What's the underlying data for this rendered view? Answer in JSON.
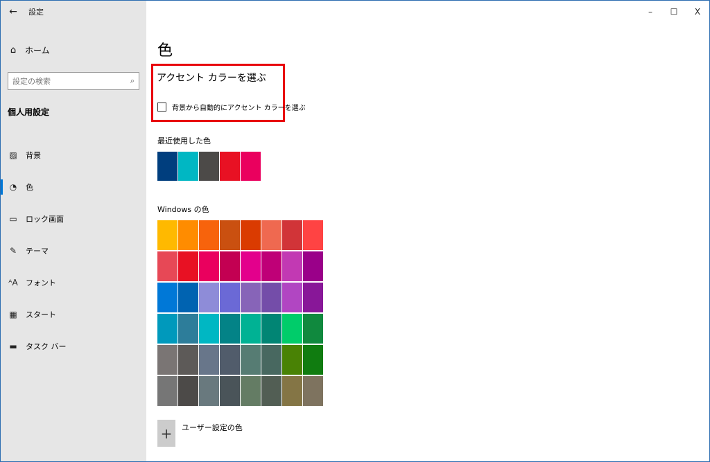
{
  "titlebar": {
    "app_title": "設定",
    "back_glyph": "←",
    "controls": {
      "minimize": "–",
      "maximize": "☐",
      "close": "X"
    }
  },
  "sidebar": {
    "home_label": "ホーム",
    "search_placeholder": "設定の検索",
    "section_title": "個人用設定",
    "items": [
      {
        "label": "背景",
        "icon": "image-icon",
        "glyph": "▨",
        "active": false
      },
      {
        "label": "色",
        "icon": "palette-icon",
        "glyph": "◔",
        "active": true
      },
      {
        "label": "ロック画面",
        "icon": "lock-screen-icon",
        "glyph": "▭",
        "active": false
      },
      {
        "label": "テーマ",
        "icon": "theme-icon",
        "glyph": "✎",
        "active": false
      },
      {
        "label": "フォント",
        "icon": "font-icon",
        "glyph": "ᴬA",
        "active": false
      },
      {
        "label": "スタート",
        "icon": "start-icon",
        "glyph": "▦",
        "active": false
      },
      {
        "label": "タスク バー",
        "icon": "taskbar-icon",
        "glyph": "▬",
        "active": false
      }
    ]
  },
  "main": {
    "page_title": "色",
    "accent_title": "アクセント カラーを選ぶ",
    "auto_accent_label": "背景から自動的にアクセント カラーを選ぶ",
    "auto_accent_checked": false,
    "recent_label": "最近使用した色",
    "recent_colors": [
      "#003e7e",
      "#00b7c3",
      "#4c4a48",
      "#e81123",
      "#ea005e"
    ],
    "windows_label": "Windows の色",
    "windows_colors": [
      "#ffb900",
      "#ff8c00",
      "#f7630c",
      "#ca5010",
      "#da3b01",
      "#ef6950",
      "#d13438",
      "#ff4343",
      "#e74856",
      "#e81123",
      "#ea005e",
      "#c30052",
      "#e3008c",
      "#bf0077",
      "#c239b3",
      "#9a0089",
      "#0078d7",
      "#0063b1",
      "#8e8cd8",
      "#6b69d6",
      "#8764b8",
      "#744da9",
      "#b146c2",
      "#881798",
      "#0099bc",
      "#2d7d9a",
      "#00b7c3",
      "#038387",
      "#00b294",
      "#018574",
      "#00cc6a",
      "#10893e",
      "#7a7574",
      "#5d5a58",
      "#68768a",
      "#515c6b",
      "#567c73",
      "#486860",
      "#498205",
      "#107c10",
      "#767676",
      "#4c4a48",
      "#69797e",
      "#4a5459",
      "#647c64",
      "#525e54",
      "#847545",
      "#7e735f"
    ],
    "custom_label": "ユーザー設定の色",
    "custom_glyph": "+"
  },
  "colors": {
    "sidebar_bg": "#e6e6e6",
    "accent": "#0078d7",
    "highlight_border": "#e8000b"
  }
}
